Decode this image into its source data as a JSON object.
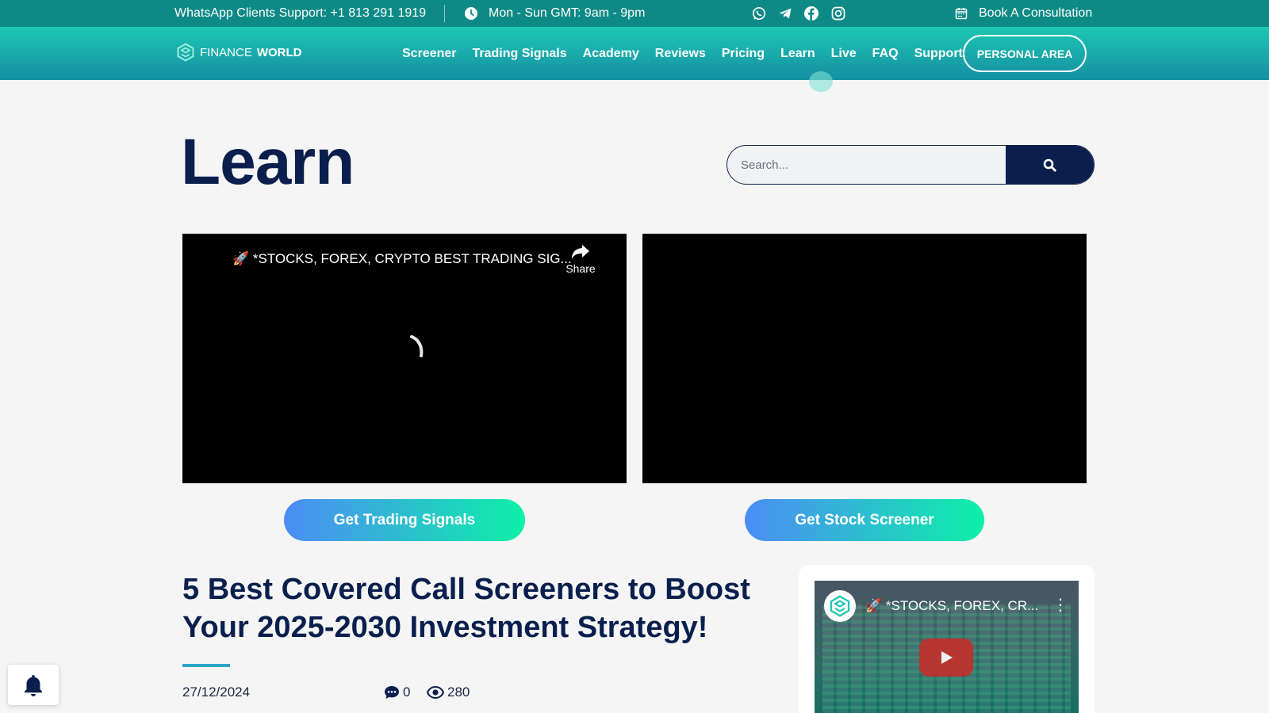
{
  "topbar": {
    "support_text": "WhatsApp Clients Support: +1 813 291 1919",
    "hours_text": "Mon - Sun GMT: 9am - 9pm",
    "consultation_label": "Book A Consultation",
    "social_icons": [
      "whatsapp-icon",
      "telegram-icon",
      "facebook-icon",
      "instagram-icon"
    ]
  },
  "brand": {
    "name_light": "FINANCE",
    "name_bold": "WORLD"
  },
  "nav": {
    "items": [
      "Screener",
      "Trading Signals",
      "Academy",
      "Reviews",
      "Pricing",
      "Learn",
      "Live",
      "FAQ",
      "Support"
    ],
    "personal_area_label": "PERSONAL AREA"
  },
  "page": {
    "title": "Learn"
  },
  "search": {
    "placeholder": "Search..."
  },
  "videos": [
    {
      "title": "🚀 *STOCKS, FOREX, CRYPTO BEST TRADING SIG...",
      "share_label": "Share"
    },
    {
      "title": ""
    }
  ],
  "cta": {
    "signals_label": "Get Trading Signals",
    "screener_label": "Get Stock Screener"
  },
  "article": {
    "title": "5 Best Covered Call Screeners to Boost Your 2025-2030 Investment Strategy!",
    "date": "27/12/2024",
    "comments": "0",
    "views": "280"
  },
  "sidebar_video": {
    "title": "🚀 *STOCKS, FOREX, CR..."
  },
  "colors": {
    "top_bar": "#0e8a86",
    "heading": "#0a1f4d",
    "accent": "#1cc7b2",
    "cta_start": "#4c8cf5",
    "cta_end": "#0df0a8"
  }
}
